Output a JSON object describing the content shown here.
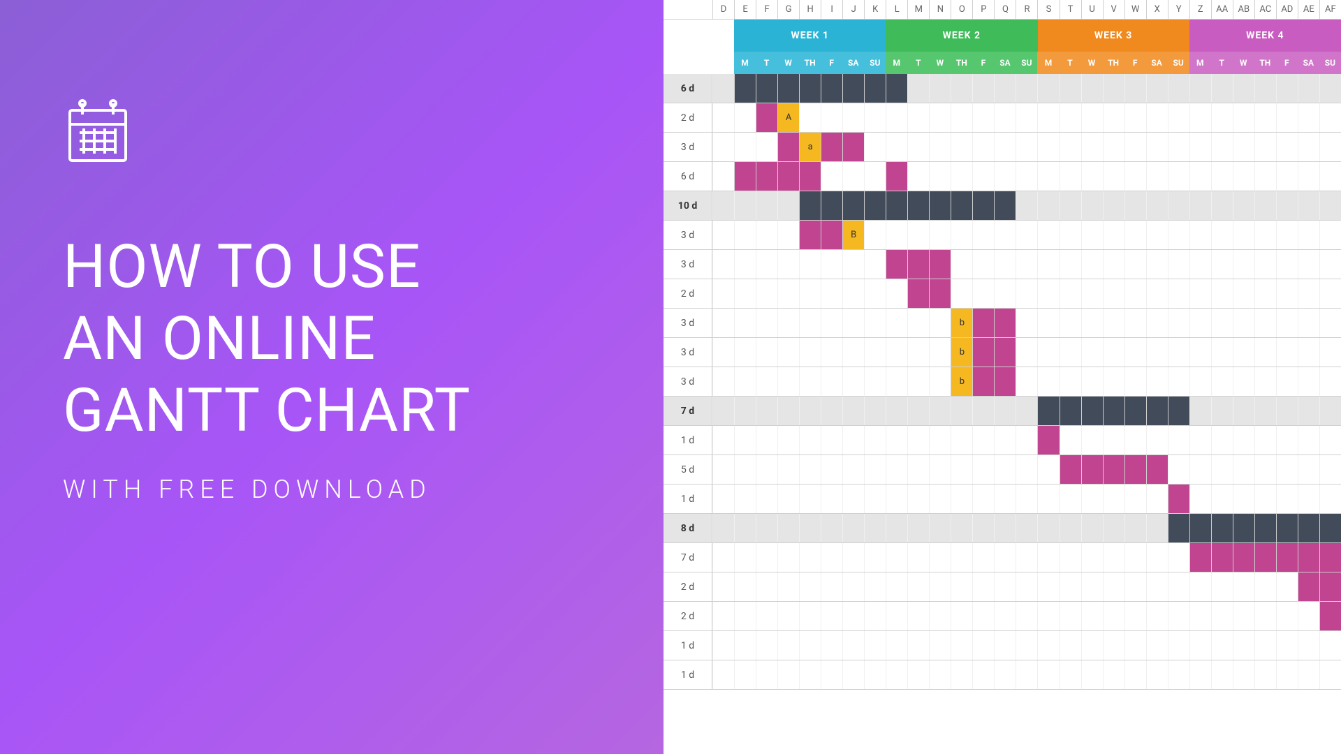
{
  "hero": {
    "title_l1": "HOW TO USE",
    "title_l2": "AN ONLINE",
    "title_l3": "GANTT CHART",
    "subtitle": "WITH FREE DOWNLOAD"
  },
  "columns": [
    "D",
    "E",
    "F",
    "G",
    "H",
    "I",
    "J",
    "K",
    "L",
    "M",
    "N",
    "O",
    "P",
    "Q",
    "R",
    "S",
    "T",
    "U",
    "V",
    "W",
    "X",
    "Y",
    "Z",
    "AA",
    "AB",
    "AC",
    "AD",
    "AE",
    "AF"
  ],
  "weeks": [
    {
      "label": "WEEK 1",
      "bg": "#2bb3d6",
      "day_bg": "#46bfdc"
    },
    {
      "label": "WEEK 2",
      "bg": "#3fbb5a",
      "day_bg": "#56c66f"
    },
    {
      "label": "WEEK 3",
      "bg": "#f08a1f",
      "day_bg": "#f39a3d"
    },
    {
      "label": "WEEK 4",
      "bg": "#c95cc0",
      "day_bg": "#d075c9"
    }
  ],
  "days": [
    "M",
    "T",
    "W",
    "TH",
    "F",
    "SA",
    "SU"
  ],
  "chart_data": {
    "type": "gantt",
    "unit": "day",
    "day_headers": [
      "M",
      "T",
      "W",
      "TH",
      "F",
      "SA",
      "SU"
    ],
    "tasks": [
      {
        "duration": "6 d",
        "summary": true,
        "bars": [
          {
            "start": 1,
            "len": 8,
            "color": "dark"
          }
        ]
      },
      {
        "duration": "2 d",
        "bars": [
          {
            "start": 2,
            "len": 1,
            "color": "pink"
          },
          {
            "start": 3,
            "len": 1,
            "color": "yellow",
            "label": "A"
          }
        ]
      },
      {
        "duration": "3 d",
        "bars": [
          {
            "start": 3,
            "len": 1,
            "color": "pink"
          },
          {
            "start": 4,
            "len": 1,
            "color": "yellow",
            "label": "a"
          },
          {
            "start": 5,
            "len": 2,
            "color": "pink"
          }
        ]
      },
      {
        "duration": "6 d",
        "bars": [
          {
            "start": 1,
            "len": 4,
            "color": "pink"
          },
          {
            "start": 8,
            "len": 1,
            "color": "pink"
          }
        ]
      },
      {
        "duration": "10 d",
        "summary": true,
        "bars": [
          {
            "start": 4,
            "len": 10,
            "color": "dark"
          }
        ]
      },
      {
        "duration": "3 d",
        "bars": [
          {
            "start": 4,
            "len": 2,
            "color": "pink"
          },
          {
            "start": 6,
            "len": 1,
            "color": "yellow",
            "label": "B"
          }
        ]
      },
      {
        "duration": "3 d",
        "bars": [
          {
            "start": 8,
            "len": 3,
            "color": "pink"
          }
        ]
      },
      {
        "duration": "2 d",
        "bars": [
          {
            "start": 9,
            "len": 2,
            "color": "pink"
          }
        ]
      },
      {
        "duration": "3 d",
        "bars": [
          {
            "start": 11,
            "len": 1,
            "color": "yellow",
            "label": "b"
          },
          {
            "start": 12,
            "len": 2,
            "color": "pink"
          }
        ]
      },
      {
        "duration": "3 d",
        "bars": [
          {
            "start": 11,
            "len": 1,
            "color": "yellow",
            "label": "b"
          },
          {
            "start": 12,
            "len": 2,
            "color": "pink"
          }
        ]
      },
      {
        "duration": "3 d",
        "bars": [
          {
            "start": 11,
            "len": 1,
            "color": "yellow",
            "label": "b"
          },
          {
            "start": 12,
            "len": 2,
            "color": "pink"
          }
        ]
      },
      {
        "duration": "7 d",
        "summary": true,
        "bars": [
          {
            "start": 15,
            "len": 7,
            "color": "dark"
          }
        ]
      },
      {
        "duration": "1 d",
        "bars": [
          {
            "start": 15,
            "len": 1,
            "color": "pink"
          }
        ]
      },
      {
        "duration": "5 d",
        "bars": [
          {
            "start": 16,
            "len": 5,
            "color": "pink"
          }
        ]
      },
      {
        "duration": "1 d",
        "bars": [
          {
            "start": 21,
            "len": 1,
            "color": "pink"
          }
        ]
      },
      {
        "duration": "8 d",
        "summary": true,
        "bars": [
          {
            "start": 21,
            "len": 8,
            "color": "dark"
          }
        ]
      },
      {
        "duration": "7 d",
        "bars": [
          {
            "start": 22,
            "len": 7,
            "color": "pink"
          }
        ]
      },
      {
        "duration": "2 d",
        "bars": [
          {
            "start": 27,
            "len": 2,
            "color": "pink"
          }
        ]
      },
      {
        "duration": "2 d",
        "bars": [
          {
            "start": 28,
            "len": 1,
            "color": "pink"
          }
        ]
      },
      {
        "duration": "1 d",
        "bars": []
      },
      {
        "duration": "1 d",
        "bars": []
      }
    ]
  }
}
